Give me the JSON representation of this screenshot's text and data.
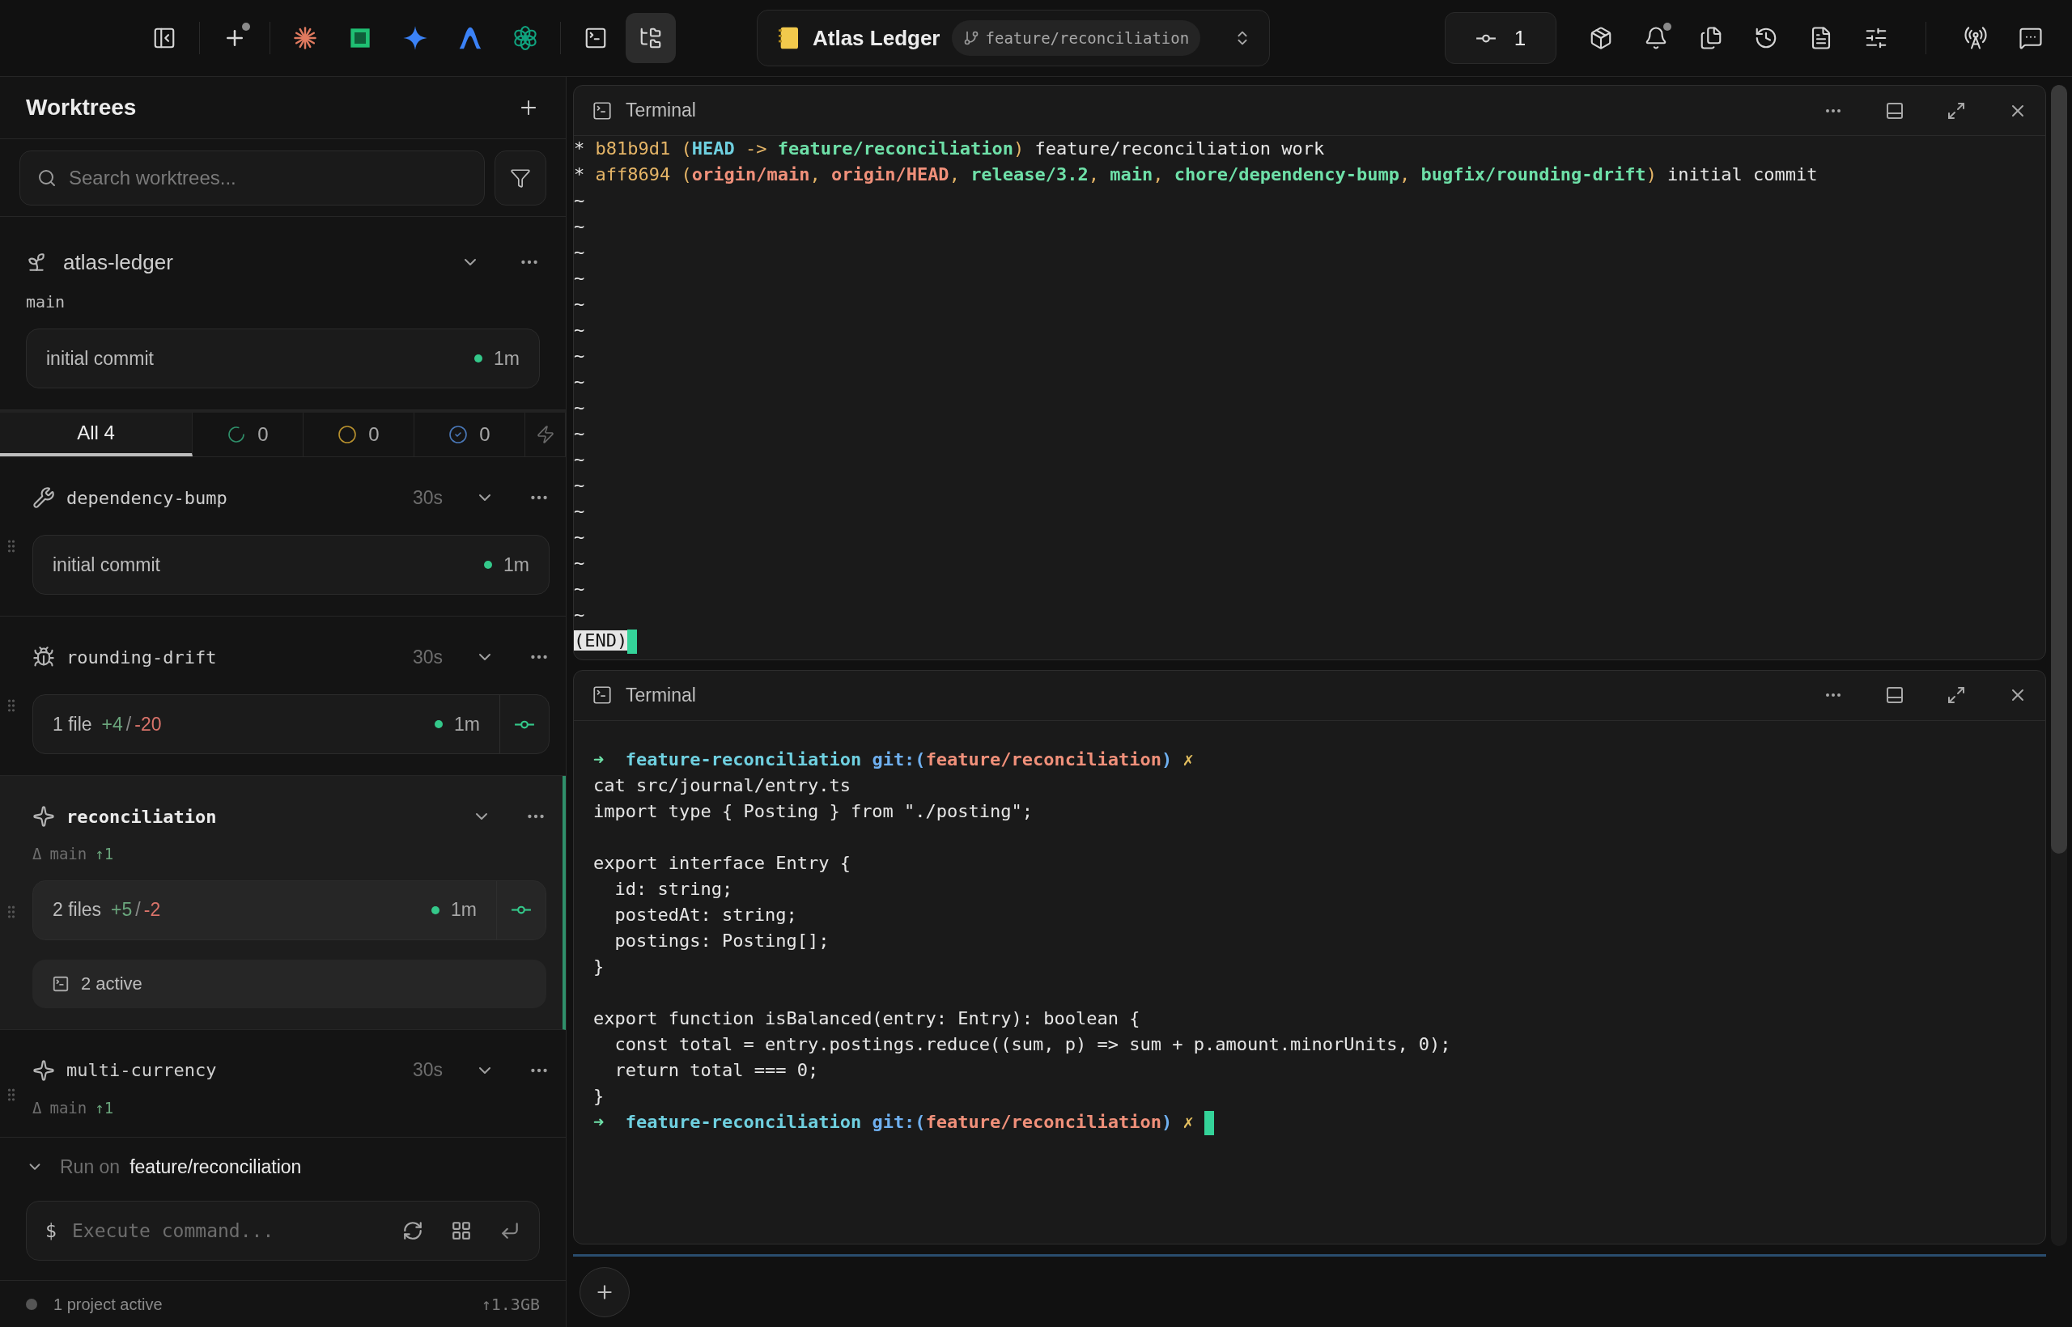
{
  "toolbar": {
    "left_tools": [
      {
        "kind": "panel",
        "selected": false,
        "badge": false
      },
      {
        "kind": "plus",
        "selected": false,
        "badge": true
      },
      {
        "kind": "burst",
        "selected": false,
        "badge": false
      },
      {
        "kind": "square",
        "selected": false,
        "badge": false
      },
      {
        "kind": "sparkle",
        "selected": false,
        "badge": false
      },
      {
        "kind": "arch",
        "selected": false,
        "badge": false
      },
      {
        "kind": "knot",
        "selected": false,
        "badge": false
      },
      {
        "kind": "terminal",
        "selected": false,
        "badge": false
      },
      {
        "kind": "tree",
        "selected": true,
        "badge": false
      }
    ],
    "project": {
      "name": "Atlas Ledger",
      "branch": "feature/reconciliation"
    },
    "commits": {
      "count": "1"
    },
    "right_tools": [
      {
        "kind": "package",
        "badge": false
      },
      {
        "kind": "bell",
        "badge": true
      },
      {
        "kind": "files",
        "badge": false
      },
      {
        "kind": "history",
        "badge": false
      },
      {
        "kind": "document",
        "badge": false
      },
      {
        "kind": "sliders",
        "badge": false
      },
      {
        "kind": "tower",
        "badge": false
      },
      {
        "kind": "chat",
        "badge": false
      }
    ]
  },
  "sidebar": {
    "title": "Worktrees",
    "search": {
      "placeholder": "Search worktrees..."
    },
    "repo": {
      "name": "atlas-ledger",
      "branch": "main",
      "commit": {
        "message": "initial commit",
        "time": "1m"
      }
    },
    "filter_tabs": [
      {
        "kind": "all",
        "label": "All 4",
        "selected": true
      },
      {
        "kind": "running",
        "label": "0",
        "selected": false,
        "color": "#2f8f6a"
      },
      {
        "kind": "pending",
        "label": "0",
        "selected": false,
        "color": "#b8912e"
      },
      {
        "kind": "done",
        "label": "0",
        "selected": false,
        "color": "#4a78b8"
      },
      {
        "kind": "auto",
        "selected": false
      }
    ],
    "worktrees": [
      {
        "name": "dependency-bump",
        "kind": "wrench",
        "age": "30s",
        "selected": false,
        "status": {
          "kind": "commit",
          "message": "initial commit",
          "time": "1m"
        }
      },
      {
        "name": "rounding-drift",
        "kind": "bug",
        "age": "30s",
        "selected": false,
        "status": {
          "kind": "changes",
          "files": "1 file",
          "added": "+4",
          "separator": "/",
          "removed": "-20",
          "time": "1m"
        }
      },
      {
        "name": "reconciliation",
        "kind": "sparkle",
        "selected": true,
        "base": {
          "mark": "Δ",
          "branch": "main",
          "ahead": "↑1"
        },
        "status": {
          "kind": "changes",
          "files": "2 files",
          "added": "+5",
          "separator": "/",
          "removed": "-2",
          "time": "1m"
        },
        "terminals": "2 active"
      },
      {
        "name": "multi-currency",
        "kind": "sparkle",
        "age": "30s",
        "selected": false,
        "base": {
          "mark": "Δ",
          "branch": "main",
          "ahead": "↑1"
        }
      }
    ],
    "run": {
      "expanded": true,
      "label": "Run on",
      "target": "feature/reconciliation",
      "prompt": "$",
      "placeholder": "Execute command..."
    },
    "footer": {
      "status": "1 project active",
      "memory": "↑1.3GB"
    }
  },
  "terminals": [
    {
      "title": "Terminal",
      "lines": [
        {
          "segments": [
            {
              "kind": "text",
              "text": "* "
            },
            {
              "kind": "hash",
              "text": "b81b9d1"
            },
            {
              "kind": "punct",
              "text": " ("
            },
            {
              "kind": "head",
              "text": "HEAD"
            },
            {
              "kind": "punct",
              "text": " -> "
            },
            {
              "kind": "local",
              "text": "feature/reconciliation"
            },
            {
              "kind": "punct",
              "text": ")"
            },
            {
              "kind": "text",
              "text": " feature/reconciliation work"
            }
          ]
        },
        {
          "segments": [
            {
              "kind": "text",
              "text": "* "
            },
            {
              "kind": "hash",
              "text": "aff8694"
            },
            {
              "kind": "punct",
              "text": " ("
            },
            {
              "kind": "remote",
              "text": "origin/main"
            },
            {
              "kind": "punct",
              "text": ", "
            },
            {
              "kind": "remote",
              "text": "origin/HEAD"
            },
            {
              "kind": "punct",
              "text": ", "
            },
            {
              "kind": "local",
              "text": "release/3.2"
            },
            {
              "kind": "punct",
              "text": ", "
            },
            {
              "kind": "local",
              "text": "main"
            },
            {
              "kind": "punct",
              "text": ", "
            },
            {
              "kind": "local",
              "text": "chore/dependency-bump"
            },
            {
              "kind": "punct",
              "text": ", "
            },
            {
              "kind": "local",
              "text": "bugfix/rounding-drift"
            },
            {
              "kind": "punct",
              "text": ")"
            },
            {
              "kind": "text",
              "text": " initial commit"
            }
          ]
        },
        {
          "segments": [
            {
              "kind": "text",
              "text": "~"
            }
          ]
        },
        {
          "segments": [
            {
              "kind": "text",
              "text": "~"
            }
          ]
        },
        {
          "segments": [
            {
              "kind": "text",
              "text": "~"
            }
          ]
        },
        {
          "segments": [
            {
              "kind": "text",
              "text": "~"
            }
          ]
        },
        {
          "segments": [
            {
              "kind": "text",
              "text": "~"
            }
          ]
        },
        {
          "segments": [
            {
              "kind": "text",
              "text": "~"
            }
          ]
        },
        {
          "segments": [
            {
              "kind": "text",
              "text": "~"
            }
          ]
        },
        {
          "segments": [
            {
              "kind": "text",
              "text": "~"
            }
          ]
        },
        {
          "segments": [
            {
              "kind": "text",
              "text": "~"
            }
          ]
        },
        {
          "segments": [
            {
              "kind": "text",
              "text": "~"
            }
          ]
        },
        {
          "segments": [
            {
              "kind": "text",
              "text": "~"
            }
          ]
        },
        {
          "segments": [
            {
              "kind": "text",
              "text": "~"
            }
          ]
        },
        {
          "segments": [
            {
              "kind": "text",
              "text": "~"
            }
          ]
        },
        {
          "segments": [
            {
              "kind": "text",
              "text": "~"
            }
          ]
        },
        {
          "segments": [
            {
              "kind": "text",
              "text": "~"
            }
          ]
        },
        {
          "segments": [
            {
              "kind": "text",
              "text": "~"
            }
          ]
        },
        {
          "segments": [
            {
              "kind": "text",
              "text": "~"
            }
          ]
        },
        {
          "cursor": true,
          "segments": [
            {
              "kind": "inverse",
              "text": "(END)"
            }
          ]
        }
      ]
    },
    {
      "title": "Terminal",
      "lines": [
        {
          "gap_before": true,
          "segments": [
            {
              "kind": "arrow",
              "text": "➜ "
            },
            {
              "kind": "dir",
              "text": " feature-reconciliation"
            },
            {
              "kind": "git",
              "text": " git:("
            },
            {
              "kind": "remote",
              "text": "feature/reconciliation"
            },
            {
              "kind": "git",
              "text": ")"
            },
            {
              "kind": "dirty",
              "text": " ✗"
            }
          ]
        },
        {
          "segments": [
            {
              "kind": "text",
              "text": "cat src/journal/entry.ts"
            }
          ]
        },
        {
          "segments": [
            {
              "kind": "text",
              "text": "import type { Posting } from \"./posting\";"
            }
          ]
        },
        {
          "gap_before": true,
          "segments": [
            {
              "kind": "text",
              "text": "export interface Entry {"
            }
          ]
        },
        {
          "segments": [
            {
              "kind": "text",
              "text": "  id: string;"
            }
          ]
        },
        {
          "segments": [
            {
              "kind": "text",
              "text": "  postedAt: string;"
            }
          ]
        },
        {
          "segments": [
            {
              "kind": "text",
              "text": "  postings: Posting[];"
            }
          ]
        },
        {
          "segments": [
            {
              "kind": "text",
              "text": "}"
            }
          ]
        },
        {
          "gap_before": true,
          "segments": [
            {
              "kind": "text",
              "text": "export function isBalanced(entry: Entry): boolean {"
            }
          ]
        },
        {
          "segments": [
            {
              "kind": "text",
              "text": "  const total = entry.postings.reduce((sum, p) => sum + p.amount.minorUnits, 0);"
            }
          ]
        },
        {
          "segments": [
            {
              "kind": "text",
              "text": "  return total === 0;"
            }
          ]
        },
        {
          "segments": [
            {
              "kind": "text",
              "text": "}"
            }
          ]
        },
        {
          "cursor": true,
          "segments": [
            {
              "kind": "arrow",
              "text": "➜ "
            },
            {
              "kind": "dir",
              "text": " feature-reconciliation"
            },
            {
              "kind": "git",
              "text": " git:("
            },
            {
              "kind": "remote",
              "text": "feature/reconciliation"
            },
            {
              "kind": "git",
              "text": ")"
            },
            {
              "kind": "dirty",
              "text": " ✗ "
            }
          ]
        }
      ]
    }
  ]
}
